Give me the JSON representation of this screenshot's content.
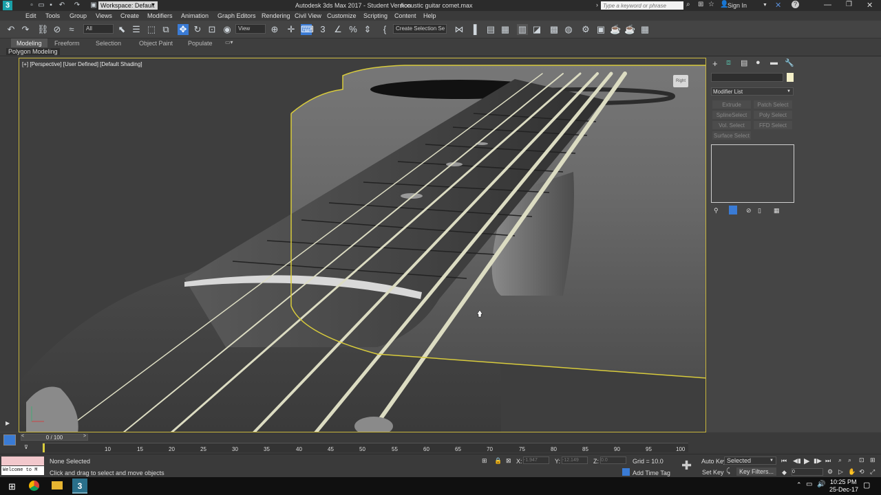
{
  "titlebar": {
    "workspace": "Workspace: Default",
    "title": "Autodesk 3ds Max 2017 - Student Version",
    "filename": "Acoustic guitar comet.max",
    "search_placeholder": "Type a keyword or phrase",
    "sign_in": "Sign In"
  },
  "menu": [
    "Edit",
    "Tools",
    "Group",
    "Views",
    "Create",
    "Modifiers",
    "Animation",
    "Graph Editors",
    "Rendering",
    "Civil View",
    "Customize",
    "Scripting",
    "Content",
    "Help"
  ],
  "toolbar": {
    "filter": "All",
    "view_dropdown": "View",
    "create_selection_set": "Create Selection Se"
  },
  "ribbon": {
    "tabs": [
      "Modeling",
      "Freeform",
      "Selection",
      "Object Paint",
      "Populate"
    ],
    "sub": "Polygon Modeling"
  },
  "viewport": {
    "label": "[+] [Perspective] [User Defined] [Default Shading]",
    "viewcube_face": "Right"
  },
  "command_panel": {
    "modifier_list": "Modifier List",
    "buttons": [
      "Extrude",
      "Patch Select",
      "SplineSelect",
      "Poly Select",
      "Vol. Select",
      "FFD Select",
      "Surface Select"
    ]
  },
  "timeline": {
    "frame_display": "0 / 100",
    "ticks": [
      "10",
      "15",
      "20",
      "25",
      "30",
      "35",
      "40",
      "45",
      "50",
      "55",
      "60",
      "65",
      "70",
      "75",
      "80",
      "85",
      "90",
      "95",
      "100"
    ]
  },
  "status": {
    "maxscript": "Welcome to M",
    "selection": "None Selected",
    "prompt": "Click and drag to select and move objects",
    "x_label": "X:",
    "x_value": "-1.947",
    "y_label": "Y:",
    "y_value": "-12.149",
    "z_label": "Z:",
    "z_value": "0.0",
    "grid": "Grid = 10.0",
    "add_time_tag": "Add Time Tag",
    "auto_key": "Auto Key",
    "set_key": "Set Key",
    "selected": "Selected",
    "key_filters": "Key Filters...",
    "frame": "0"
  },
  "taskbar": {
    "time": "10:25 PM",
    "date": "25-Dec-17"
  },
  "colors": {
    "selection_outline": "#d9cc3c",
    "viewport_bg": "#3f3f3f",
    "accent_blue": "#3a7bd5"
  }
}
